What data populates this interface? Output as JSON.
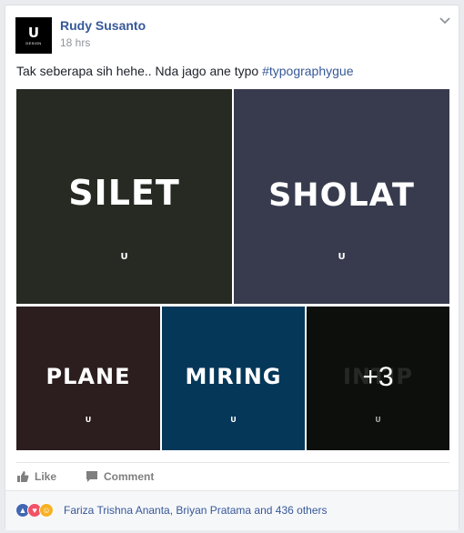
{
  "post": {
    "author": "Rudy Susanto",
    "time": "18 hrs",
    "text": "Tak seberapa sih hehe.. Nda jago ane typo ",
    "hashtag": "#typographygue",
    "avatar_mark": "U",
    "avatar_sub": "DESIGN"
  },
  "photos": [
    {
      "word": "SILET",
      "bg": "#272a23"
    },
    {
      "word": "SHOLAT",
      "bg": "#373b4d"
    },
    {
      "word": "PLANE",
      "bg": "#2c1e1f"
    },
    {
      "word": "MIRING",
      "bg": "#053759"
    },
    {
      "word": "INTIP",
      "bg": "#141814"
    }
  ],
  "photo_logo": "U",
  "more_photos": "+3",
  "actions": {
    "like": "Like",
    "comment": "Comment"
  },
  "reactions": {
    "icons": [
      "like-icon",
      "love-icon",
      "haha-icon"
    ],
    "text": "Fariza Trishna Ananta, Briyan Pratama and 436 others"
  },
  "colors": {
    "link": "#365899",
    "meta": "#90949c",
    "text": "#1d2129"
  }
}
